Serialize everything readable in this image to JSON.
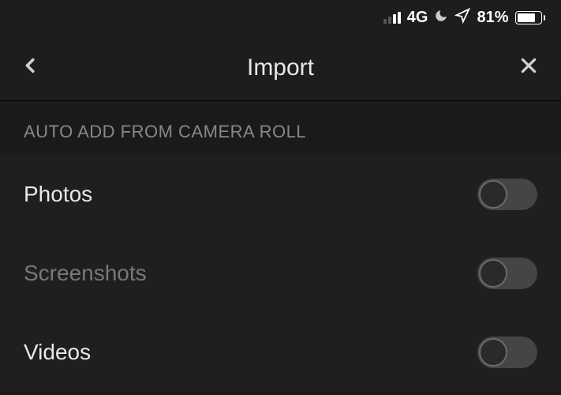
{
  "status": {
    "network": "4G",
    "battery_pct": "81%",
    "battery_fill_width": "81%"
  },
  "nav": {
    "title": "Import"
  },
  "section": {
    "header": "AUTO ADD FROM CAMERA ROLL"
  },
  "settings": [
    {
      "label": "Photos",
      "dim": false,
      "on": false
    },
    {
      "label": "Screenshots",
      "dim": true,
      "on": false
    },
    {
      "label": "Videos",
      "dim": false,
      "on": false
    }
  ]
}
